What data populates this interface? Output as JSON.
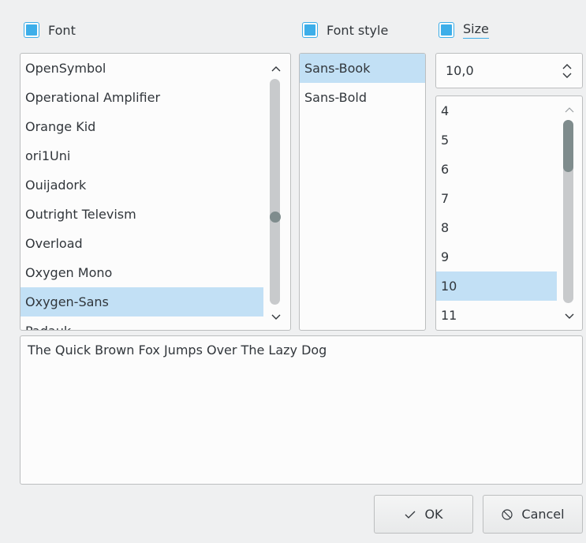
{
  "font_column": {
    "header_label": "Font",
    "checked": true,
    "items": [
      {
        "label": "OpenSymbol",
        "selected": false
      },
      {
        "label": "Operational Amplifier",
        "selected": false
      },
      {
        "label": "Orange Kid",
        "selected": false
      },
      {
        "label": "ori1Uni",
        "selected": false
      },
      {
        "label": "Ouijadork",
        "selected": false
      },
      {
        "label": "Outright Televism",
        "selected": false
      },
      {
        "label": "Overload",
        "selected": false
      },
      {
        "label": "Oxygen Mono",
        "selected": false
      },
      {
        "label": "Oxygen-Sans",
        "selected": true
      },
      {
        "label": "Padauk",
        "selected": false
      }
    ]
  },
  "style_column": {
    "header_label": "Font style",
    "checked": true,
    "items": [
      {
        "label": "Sans-Book",
        "selected": true
      },
      {
        "label": "Sans-Bold",
        "selected": false
      }
    ]
  },
  "size_column": {
    "header_label": "Size",
    "checked": true,
    "spin_value": "10,0",
    "items": [
      {
        "label": "4",
        "selected": false
      },
      {
        "label": "5",
        "selected": false
      },
      {
        "label": "6",
        "selected": false
      },
      {
        "label": "7",
        "selected": false
      },
      {
        "label": "8",
        "selected": false
      },
      {
        "label": "9",
        "selected": false
      },
      {
        "label": "10",
        "selected": true
      },
      {
        "label": "11",
        "selected": false
      }
    ]
  },
  "preview": {
    "text": "The Quick Brown Fox Jumps Over The Lazy Dog"
  },
  "buttons": {
    "ok_label": "OK",
    "cancel_label": "Cancel"
  },
  "colors": {
    "accent": "#3daee9",
    "selection": "#c2e0f5",
    "window_bg": "#eff0f1",
    "text": "#31363b"
  },
  "icons": {
    "ok": "check-icon",
    "cancel": "cancel-circle-icon"
  }
}
